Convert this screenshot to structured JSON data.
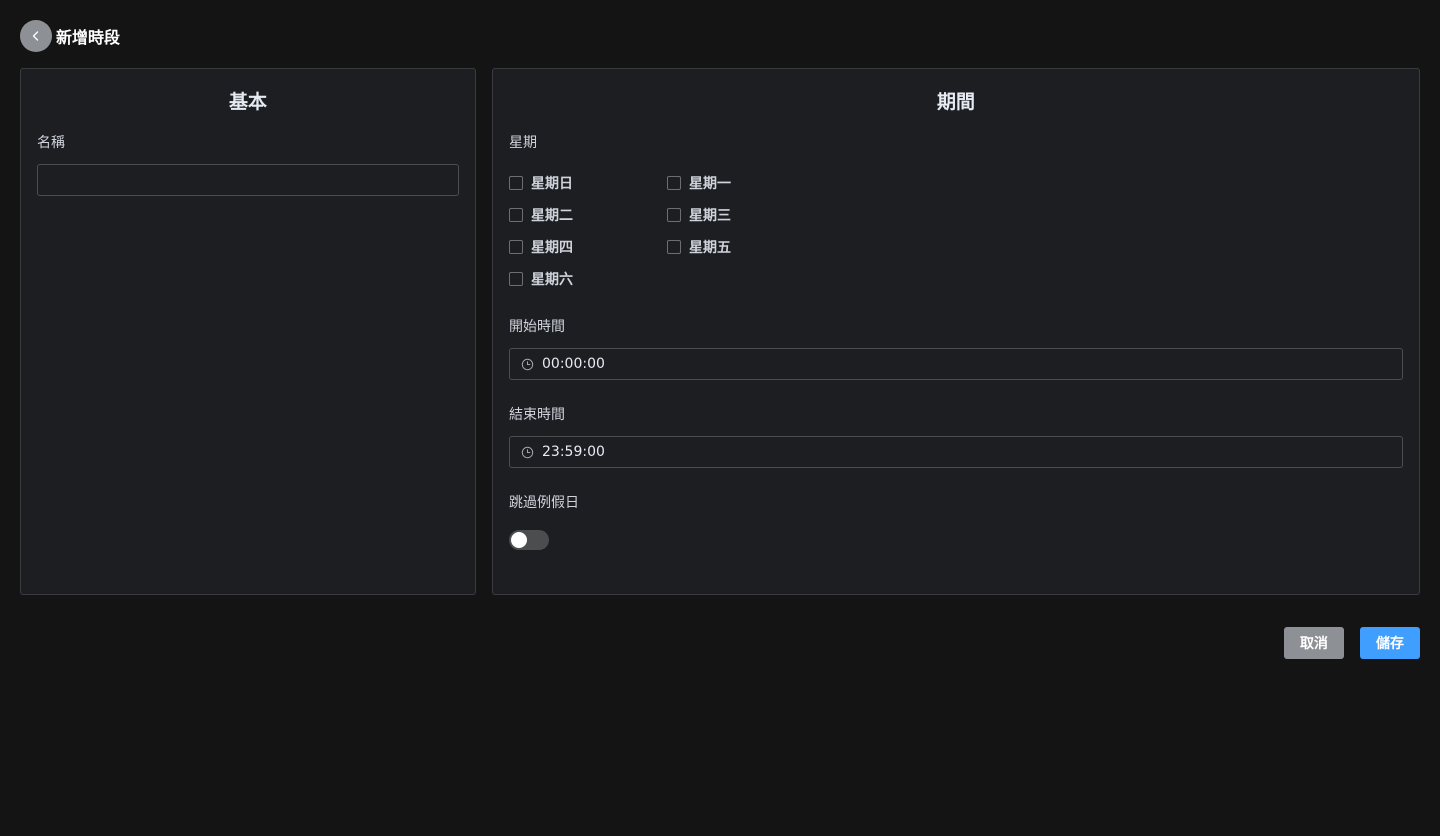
{
  "header": {
    "title": "新增時段",
    "back_icon": "chevron-left-icon"
  },
  "basic": {
    "title": "基本",
    "name_label": "名稱",
    "name_value": "",
    "name_placeholder": ""
  },
  "period": {
    "title": "期間",
    "weekday_label": "星期",
    "weekdays": [
      "星期日",
      "星期一",
      "星期二",
      "星期三",
      "星期四",
      "星期五",
      "星期六"
    ],
    "start_label": "開始時間",
    "start_value": "00:00:00",
    "end_label": "結束時間",
    "end_value": "23:59:00",
    "skip_holiday_label": "跳過例假日",
    "skip_holiday_on": false,
    "clock_icon": "clock-icon"
  },
  "actions": {
    "cancel_label": "取消",
    "save_label": "儲存"
  },
  "colors": {
    "background": "#141414",
    "panel": "#1d1e21",
    "primary": "#409eff",
    "secondary": "#8d9095"
  }
}
